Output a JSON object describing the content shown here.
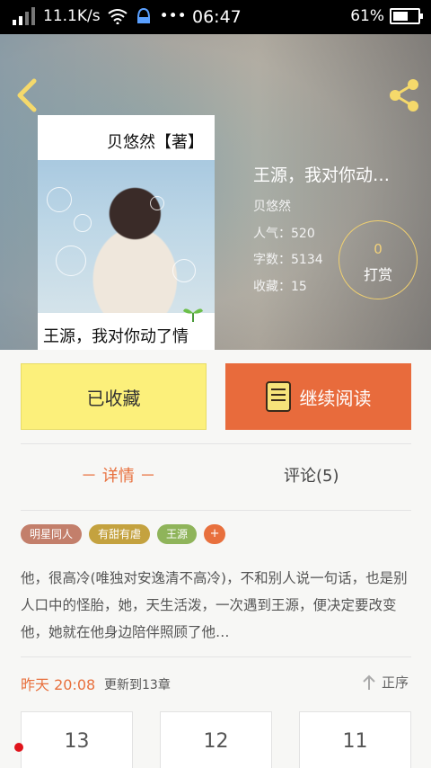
{
  "status_bar": {
    "speed": "11.1K/s",
    "time": "06:47",
    "battery": "61%",
    "battery_level": 0.61
  },
  "book": {
    "cover_author_line": "贝悠然【著】",
    "cover_title_line": "王源，我对你动了情",
    "title": "王源，我对你动…",
    "author": "贝悠然",
    "popularity": "人气：520",
    "word_count": "字数：5134",
    "favorites": "收藏：15"
  },
  "reward": {
    "count": "0",
    "label": "打赏"
  },
  "actions": {
    "favorited_label": "已收藏",
    "continue_label": "继续阅读"
  },
  "tabs": {
    "details": "－ 详情 －",
    "comments": "评论(5)"
  },
  "tags": [
    {
      "label": "明星同人",
      "color": "#c37f6b"
    },
    {
      "label": "有甜有虐",
      "color": "#c4a23f"
    },
    {
      "label": "王源",
      "color": "#8fb45a"
    }
  ],
  "tag_add": "+",
  "description": "他，很高冷(唯独对安逸清不高冷)，不和别人说一句话，也是别人口中的怪胎，她，天生活泼，一次遇到王源，便决定要改变他，她就在他身边陪伴照顾了他…",
  "update": {
    "time": "昨天 20:08",
    "text": "更新到13章",
    "sort_label": "正序"
  },
  "chapters": [
    "13",
    "12",
    "11"
  ],
  "colors": {
    "accent": "#e8703d",
    "favorite_bg": "#fcf07b",
    "continue_bg": "#e86b3c"
  }
}
